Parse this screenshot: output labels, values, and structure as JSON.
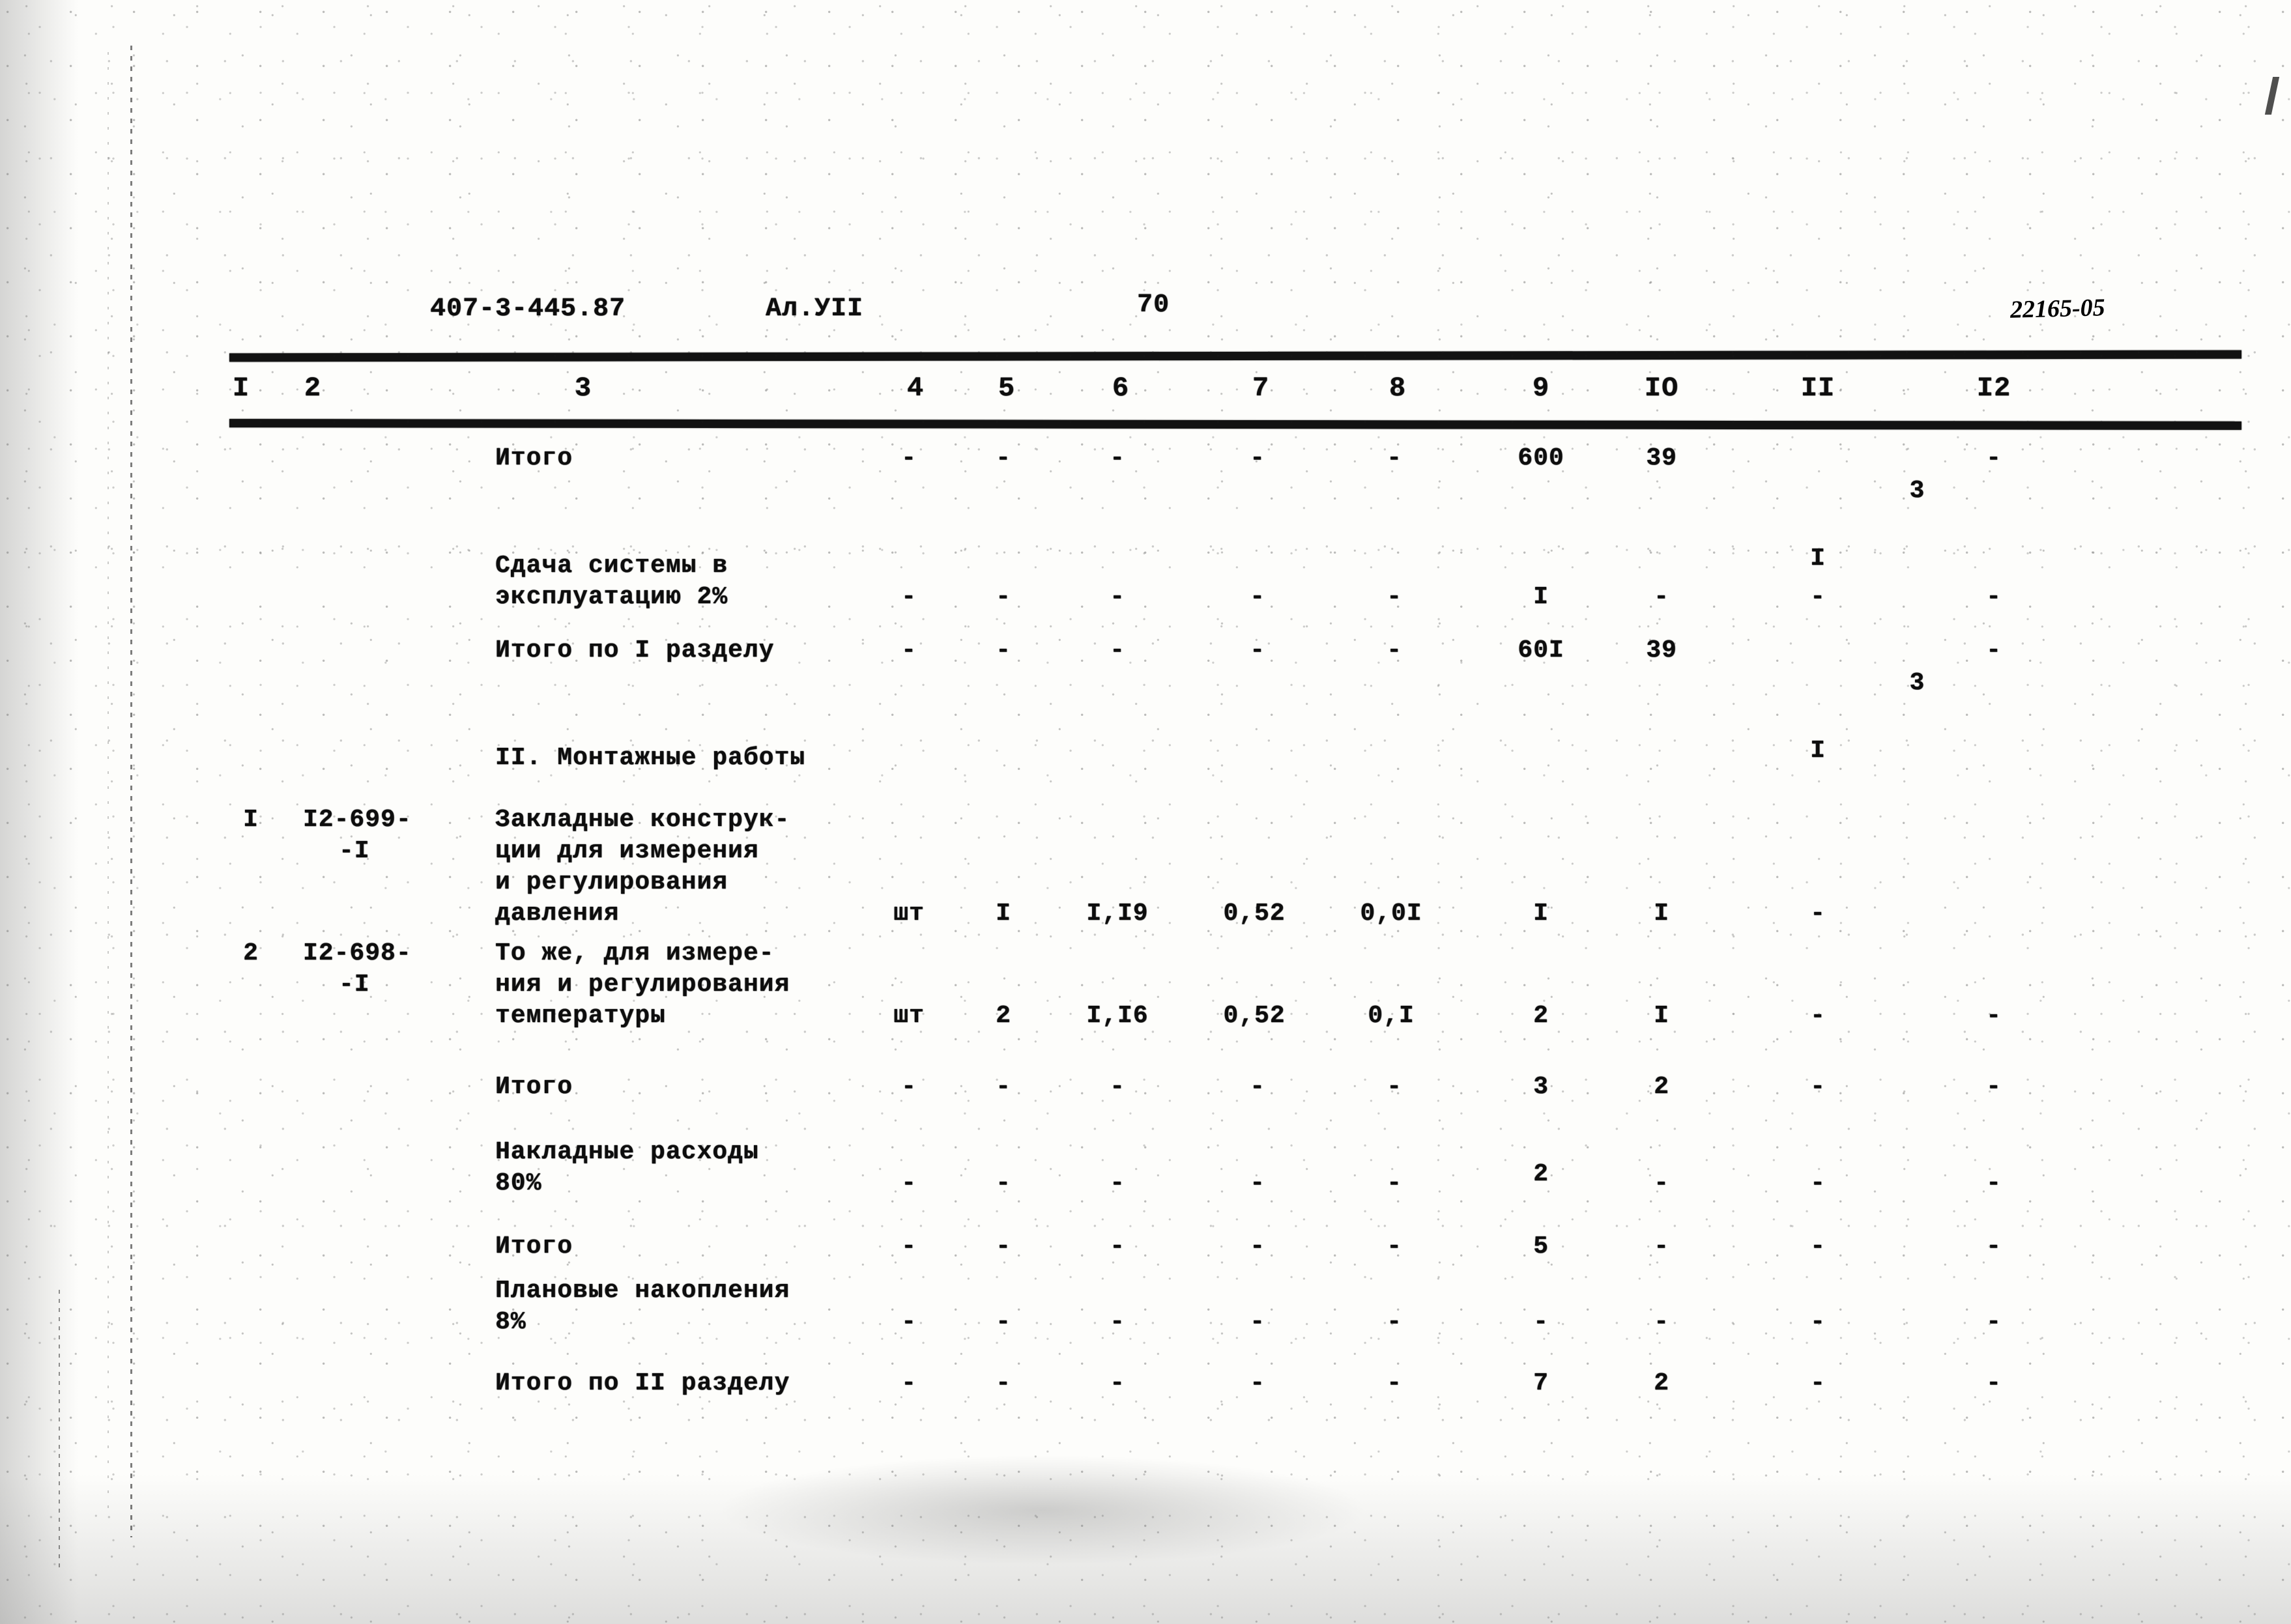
{
  "header": {
    "doc_number": "407-3-445.87",
    "album": "Ал.УII",
    "page_number": "70",
    "archive_code": "22165-05"
  },
  "table": {
    "column_numbers": [
      "I",
      "2",
      "3",
      "4",
      "5",
      "6",
      "7",
      "8",
      "9",
      "IO",
      "II",
      "I2"
    ],
    "rows": [
      {
        "c1": "",
        "c2": "",
        "c3": "Итого",
        "c4": "-",
        "c5": "-",
        "c6": "-",
        "c7": "-",
        "c8": "-",
        "c9": "600",
        "c10": "39",
        "c11_num": "3",
        "c11_den": "I",
        "c12": "-"
      },
      {
        "c1": "",
        "c2": "",
        "c3": "Сдача системы в",
        "c3b": "эксплуатацию 2%",
        "c4": "-",
        "c5": "-",
        "c6": "-",
        "c7": "-",
        "c8": "-",
        "c9": "I",
        "c10": "-",
        "c11": "-",
        "c12": "-"
      },
      {
        "c1": "",
        "c2": "",
        "c3": "Итого по I разделу",
        "c4": "-",
        "c5": "-",
        "c6": "-",
        "c7": "-",
        "c8": "-",
        "c9": "60I",
        "c10": "39",
        "c11_num": "3",
        "c11_den": "I",
        "c12": "-"
      },
      {
        "c1": "",
        "c2": "",
        "c3": "II. Монтажные работы",
        "c4": "",
        "c5": "",
        "c6": "",
        "c7": "",
        "c8": "",
        "c9": "",
        "c10": "",
        "c11": "",
        "c12": ""
      },
      {
        "c1": "I",
        "c2": "I2-699-",
        "c2b": "-I",
        "c3": "Закладные конструк-",
        "c3b": "ции для измерения",
        "c3c": "и регулирования",
        "c3d": "давления",
        "c4": "шт",
        "c5": "I",
        "c6": "I,I9",
        "c7": "0,52",
        "c8": "0,0I",
        "c9": "I",
        "c10": "I",
        "c11": "-",
        "c12": ""
      },
      {
        "c1": "2",
        "c2": "I2-698-",
        "c2b": "-I",
        "c3": "То же, для измере-",
        "c3b": "ния и регулирования",
        "c3c": "температуры",
        "c4": "шт",
        "c5": "2",
        "c6": "I,I6",
        "c7": "0,52",
        "c8": "0,I",
        "c9": "2",
        "c10": "I",
        "c11": "-",
        "c12": "-"
      },
      {
        "c1": "",
        "c2": "",
        "c3": "Итого",
        "c4": "-",
        "c5": "-",
        "c6": "-",
        "c7": "-",
        "c8": "-",
        "c9": "3",
        "c10": "2",
        "c11": "-",
        "c12": "-"
      },
      {
        "c1": "",
        "c2": "",
        "c3": "Накладные расходы",
        "c3b": "80%",
        "c4": "-",
        "c5": "-",
        "c6": "-",
        "c7": "-",
        "c8": "-",
        "c9": "2",
        "c10": "-",
        "c11": "-",
        "c12": "-"
      },
      {
        "c1": "",
        "c2": "",
        "c3": "Итого",
        "c4": "-",
        "c5": "-",
        "c6": "-",
        "c7": "-",
        "c8": "-",
        "c9": "5",
        "c10": "-",
        "c11": "-",
        "c12": "-"
      },
      {
        "c1": "",
        "c2": "",
        "c3": "Плановые накопления",
        "c3b": "8%",
        "c4": "-",
        "c5": "-",
        "c6": "-",
        "c7": "-",
        "c8": "-",
        "c9": "-",
        "c10": "-",
        "c11": "-",
        "c12": "-"
      },
      {
        "c1": "",
        "c2": "",
        "c3": "Итого по II разделу",
        "c4": "-",
        "c5": "-",
        "c6": "-",
        "c7": "-",
        "c8": "-",
        "c9": "7",
        "c10": "2",
        "c11": "-",
        "c12": "-"
      }
    ]
  }
}
